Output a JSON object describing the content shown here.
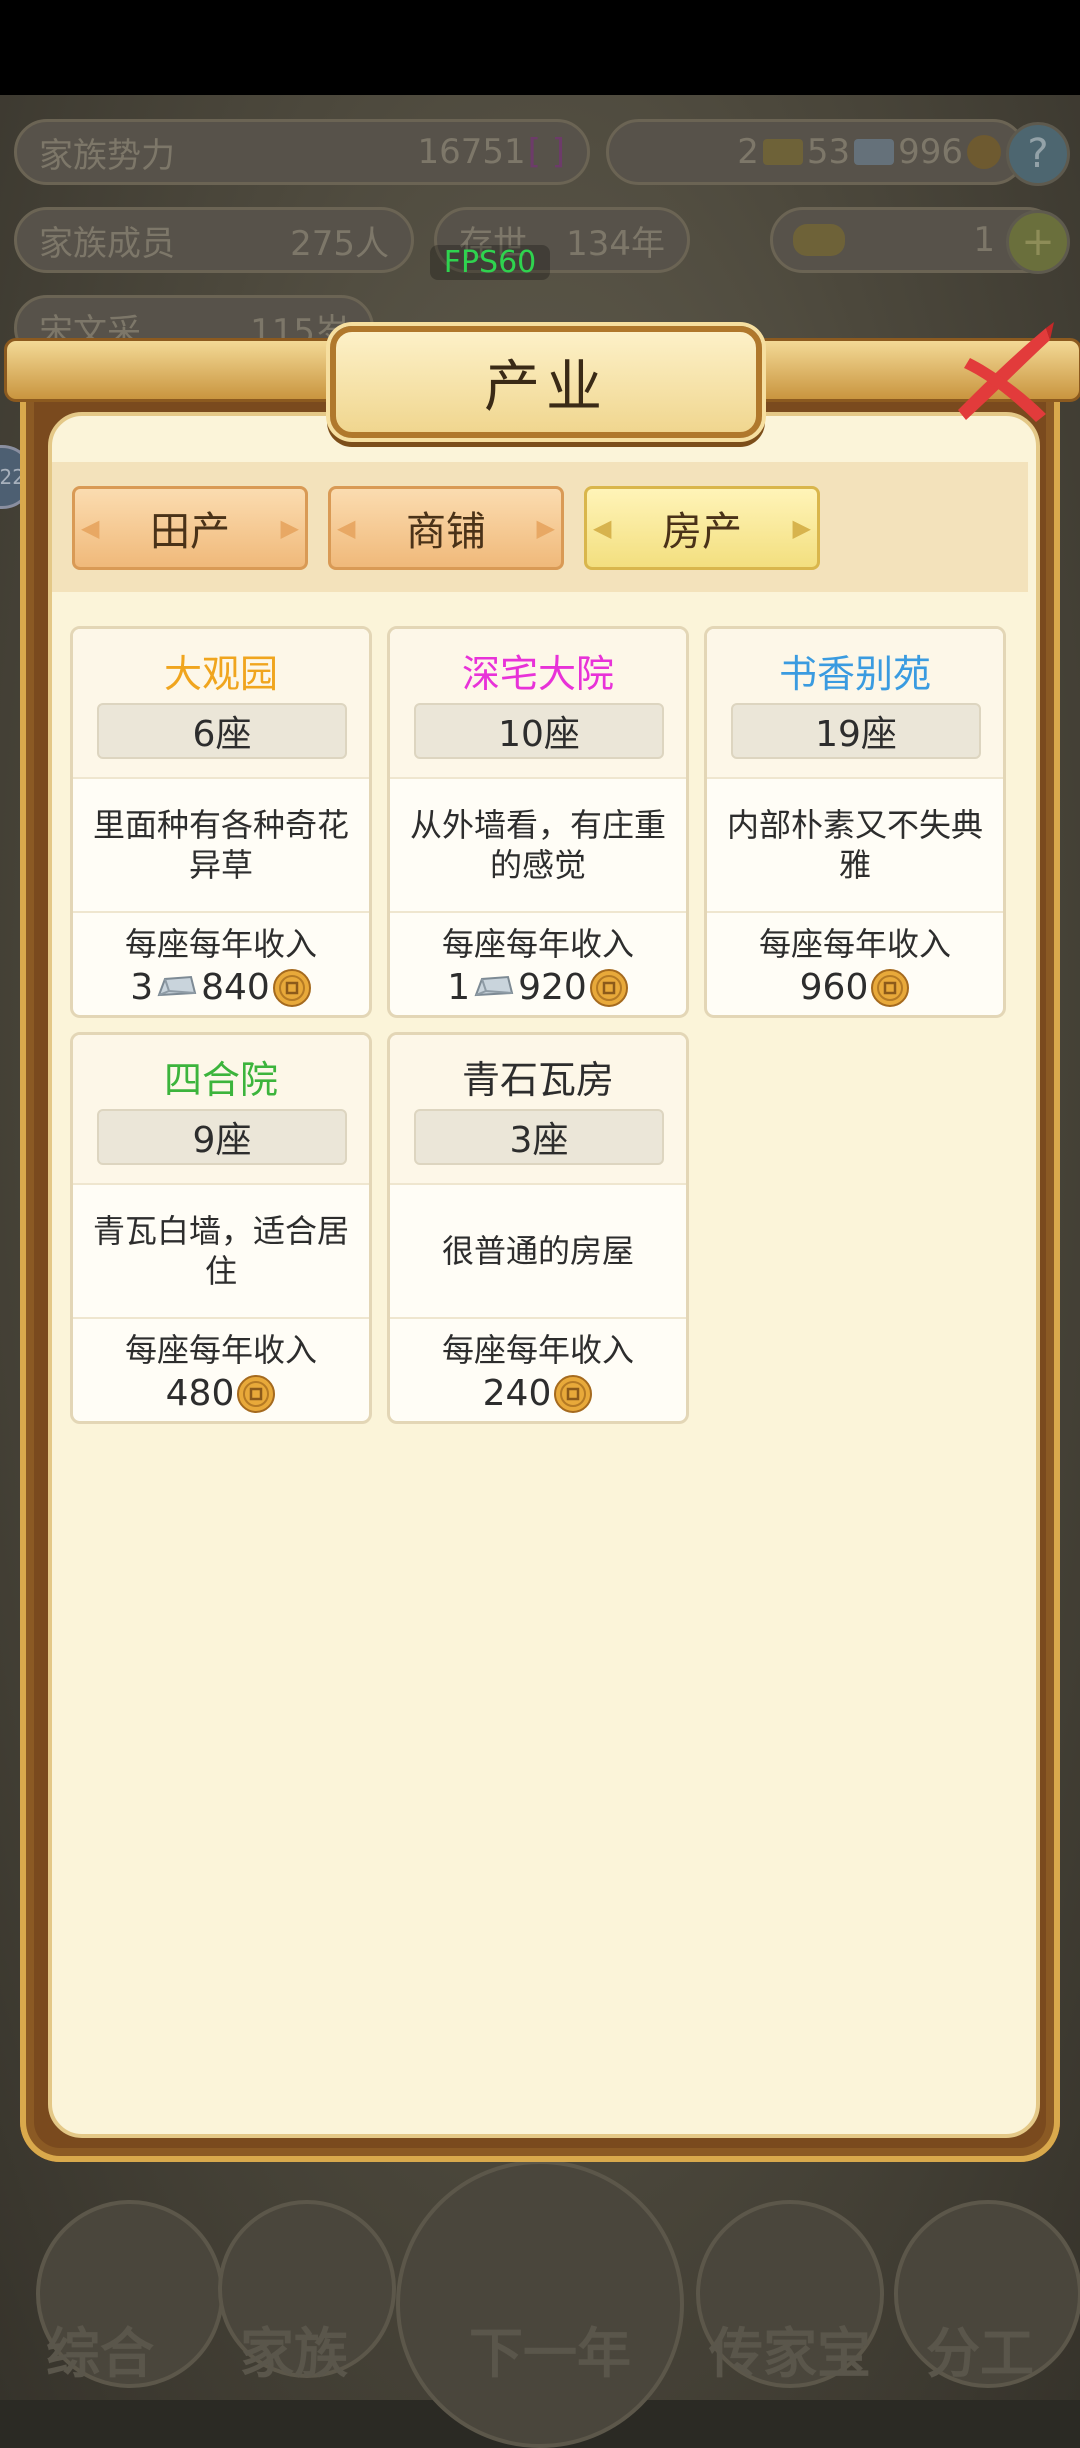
{
  "hud": {
    "power_label": "家族势力",
    "power_value": "16751",
    "power_tag": "[ ]",
    "gold": "2",
    "silver": "53",
    "coins": "996",
    "members_label": "家族成员",
    "members_value": "275人",
    "alive_label": "存世",
    "alive_value": "134年",
    "ingot": "1",
    "person_label": "宋文采",
    "person_age": "115岁",
    "fps": "FPS60",
    "side_badge": "22"
  },
  "panel": {
    "title": "产业",
    "tabs": [
      {
        "label": "田产",
        "active": false
      },
      {
        "label": "商铺",
        "active": false
      },
      {
        "label": "房产",
        "active": true
      }
    ],
    "income_label": "每座每年收入",
    "cards": [
      {
        "name": "大观园",
        "name_color": "#f0a51e",
        "count": "6座",
        "desc": "里面种有各种奇花异草",
        "silver": "3",
        "coins": "840"
      },
      {
        "name": "深宅大院",
        "name_color": "#e832d8",
        "count": "10座",
        "desc": "从外墙看，有庄重的感觉",
        "silver": "1",
        "coins": "920"
      },
      {
        "name": "书香别苑",
        "name_color": "#3a9be0",
        "count": "19座",
        "desc": "内部朴素又不失典雅",
        "silver": "",
        "coins": "960"
      },
      {
        "name": "四合院",
        "name_color": "#3cb43c",
        "count": "9座",
        "desc": "青瓦白墙，适合居住",
        "silver": "",
        "coins": "480"
      },
      {
        "name": "青石瓦房",
        "name_color": "#2d2d2d",
        "count": "3座",
        "desc": "很普通的房屋",
        "silver": "",
        "coins": "240"
      }
    ]
  },
  "nav": {
    "items": [
      "综合",
      "家族",
      "下一年",
      "传家宝",
      "分工"
    ]
  }
}
